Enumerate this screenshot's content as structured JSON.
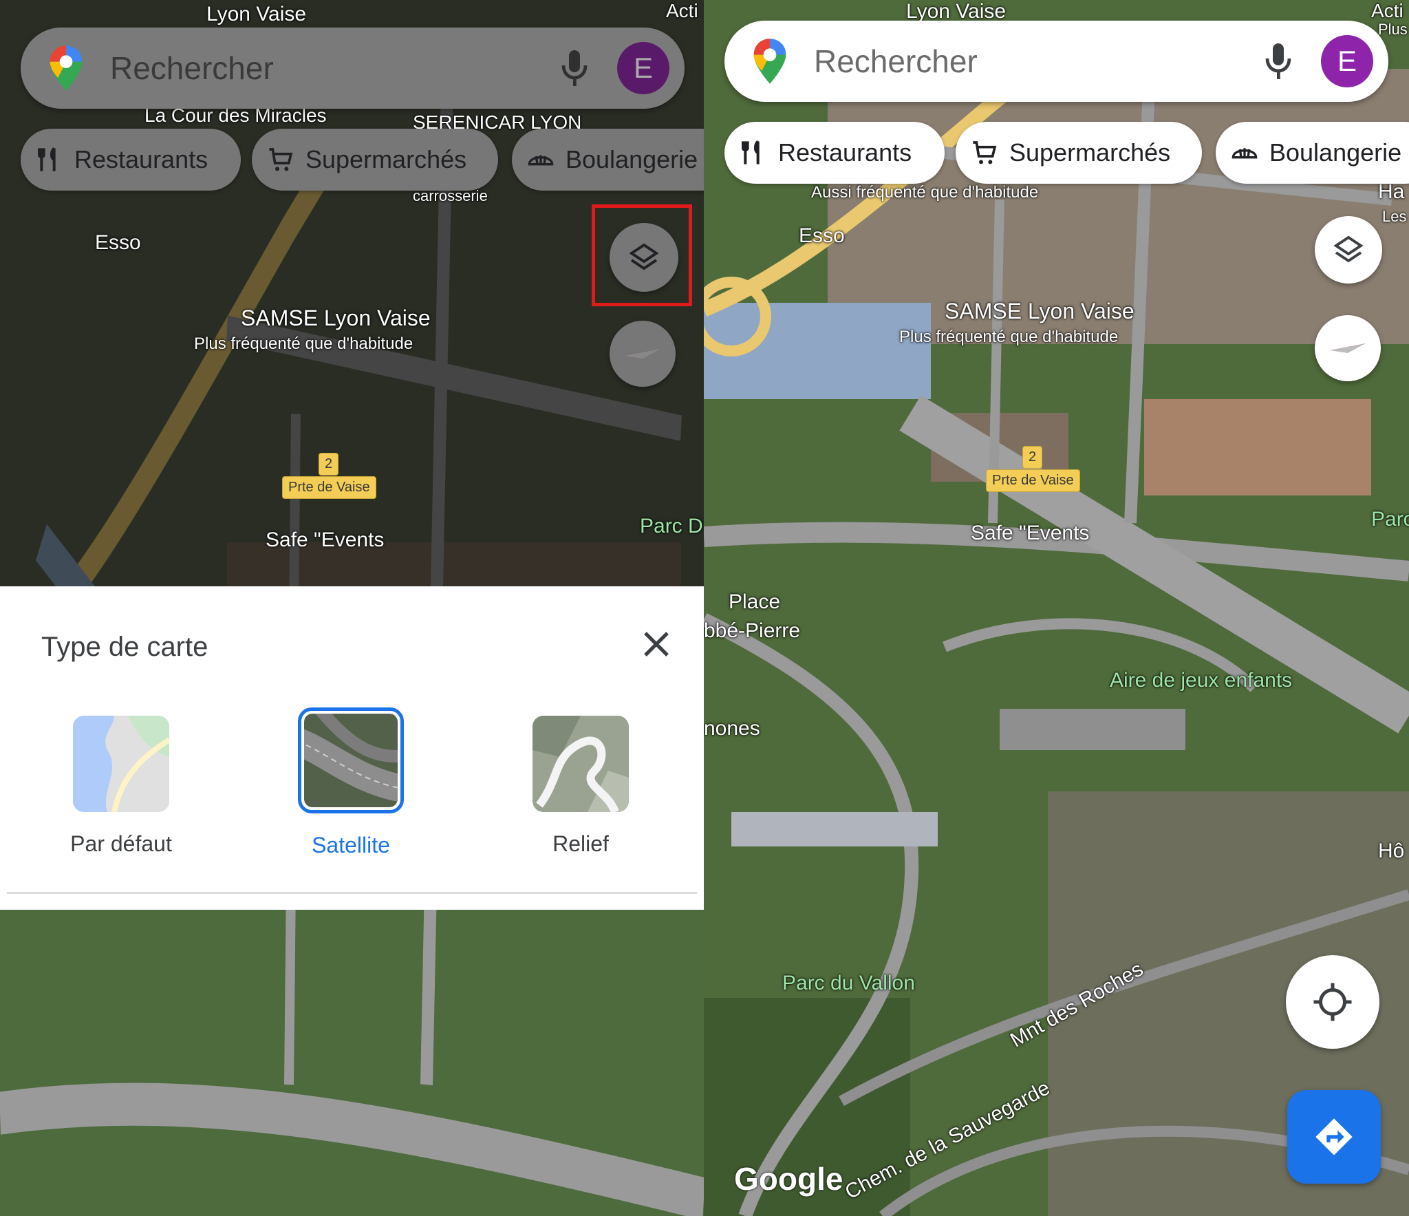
{
  "search": {
    "placeholder": "Rechercher",
    "avatar_letter": "E"
  },
  "chips": [
    {
      "label": "Restaurants",
      "icon": "fork-knife-icon"
    },
    {
      "label": "Supermarchés",
      "icon": "cart-icon"
    },
    {
      "label": "Boulangerie",
      "icon": "bread-icon"
    }
  ],
  "map_labels": {
    "lyon_vaise": "Lyon Vaise",
    "cour_miracles": "La Cour des Miracles",
    "serenicar": "SERENICAR LYON",
    "carrosserie": "carrosserie",
    "esso": "Esso",
    "samse": "SAMSE Lyon Vaise",
    "samse_sub": "Plus fréquenté que d'habitude",
    "aussi": "Aussi fréquenté que d'habitude",
    "prte_num": "2",
    "prte_de_vaise": "Prte de Vaise",
    "safe_events": "Safe \"Events",
    "parc_d": "Parc D",
    "place": "Place",
    "abbe_pierre": "bbé-Pierre",
    "aire_jeux": "Aire de jeux enfants",
    "nones": "nones",
    "parc_vallon": "Parc du Vallon",
    "mnt_roches": "Mnt des Roches",
    "chem_sauvegarde": "Chem. de la Sauvegarde",
    "ho": "Hô",
    "les": "Les",
    "ha": "Ha",
    "act": "Acti",
    "plus_f": "Plus f"
  },
  "sheet": {
    "title": "Type de carte",
    "types": [
      {
        "name": "Par défaut",
        "selected": false
      },
      {
        "name": "Satellite",
        "selected": true
      },
      {
        "name": "Relief",
        "selected": false
      }
    ]
  },
  "logo": "Google",
  "colors": {
    "accent": "#1a73e8",
    "highlight": "#e11b1b",
    "avatar": "#8e24aa"
  }
}
